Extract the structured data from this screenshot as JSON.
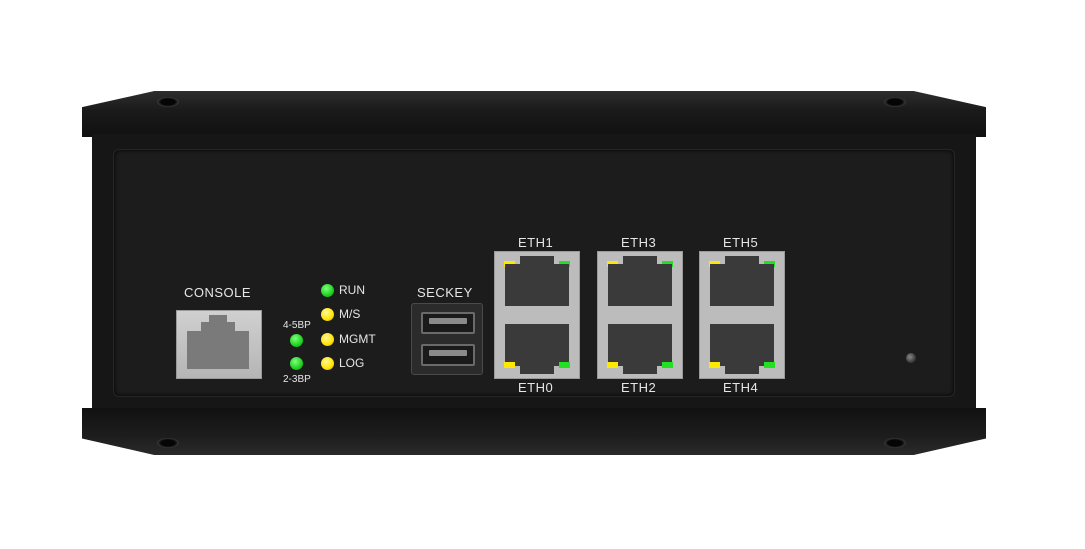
{
  "device": {
    "console_label": "CONSOLE",
    "seckey_label": "SECKEY",
    "status_leds": [
      {
        "label": "RUN",
        "color": "#22dd22"
      },
      {
        "label": "M/S",
        "color": "#ffe400"
      },
      {
        "label": "MGMT",
        "color": "#ffe400"
      },
      {
        "label": "LOG",
        "color": "#ffe400"
      }
    ],
    "bypass_leds": [
      {
        "label": "4-5BP",
        "color": "#22dd22"
      },
      {
        "label": "2-3BP",
        "color": "#22dd22"
      }
    ],
    "eth_top": [
      "ETH1",
      "ETH3",
      "ETH5"
    ],
    "eth_bottom": [
      "ETH0",
      "ETH2",
      "ETH4"
    ]
  }
}
